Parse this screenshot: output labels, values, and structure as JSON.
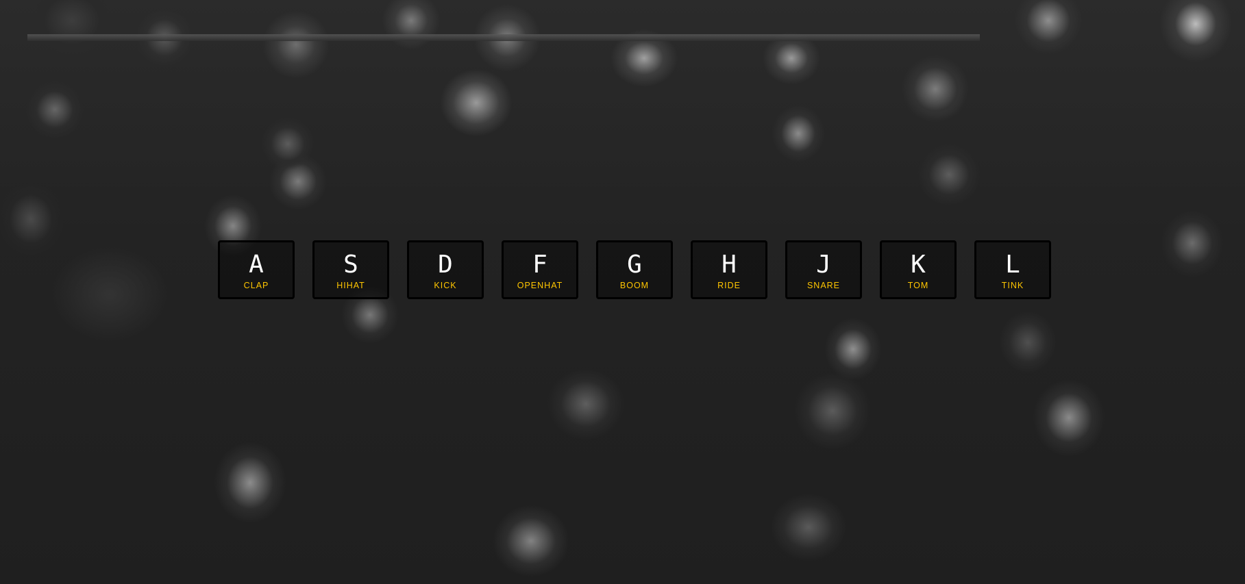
{
  "keys": [
    {
      "letter": "A",
      "sound": "clap"
    },
    {
      "letter": "S",
      "sound": "hihat"
    },
    {
      "letter": "D",
      "sound": "kick"
    },
    {
      "letter": "F",
      "sound": "openhat"
    },
    {
      "letter": "G",
      "sound": "boom"
    },
    {
      "letter": "H",
      "sound": "ride"
    },
    {
      "letter": "J",
      "sound": "snare"
    },
    {
      "letter": "K",
      "sound": "tom"
    },
    {
      "letter": "L",
      "sound": "tink"
    }
  ],
  "colors": {
    "key_letter": "#ffffff",
    "sound_label": "#ffc600",
    "key_border": "#000000"
  }
}
